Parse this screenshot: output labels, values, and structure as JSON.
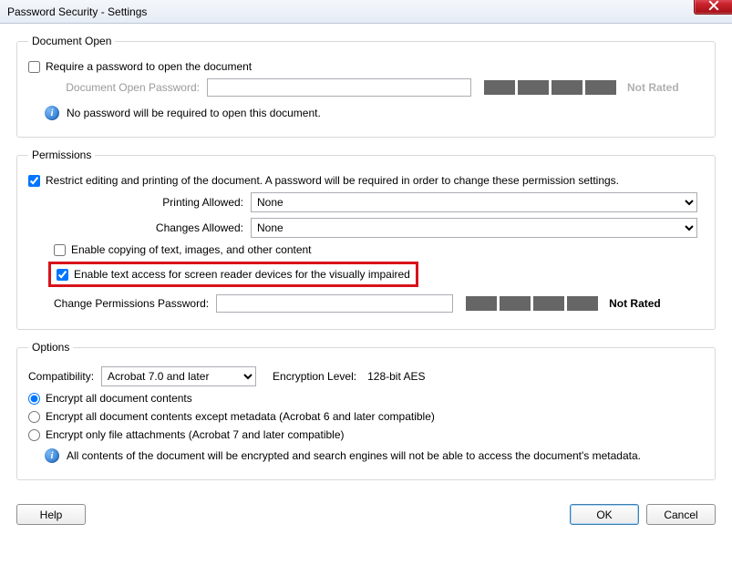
{
  "window": {
    "title": "Password Security - Settings"
  },
  "document_open": {
    "legend": "Document Open",
    "require_label": "Require a password to open the document",
    "require_checked": false,
    "password_label": "Document Open Password:",
    "password_value": "",
    "strength_label": "Not Rated",
    "info_text": "No password will be required to open this document."
  },
  "permissions": {
    "legend": "Permissions",
    "restrict_label": "Restrict editing and printing of the document. A password will be required in order to change these permission settings.",
    "restrict_checked": true,
    "printing_label": "Printing Allowed:",
    "printing_value": "None",
    "changes_label": "Changes Allowed:",
    "changes_value": "None",
    "copy_label": "Enable copying of text, images, and other content",
    "copy_checked": false,
    "access_label": "Enable text access for screen reader devices for the visually impaired",
    "access_checked": true,
    "change_pw_label": "Change Permissions Password:",
    "change_pw_value": "",
    "strength_label": "Not Rated"
  },
  "options": {
    "legend": "Options",
    "compat_label": "Compatibility:",
    "compat_value": "Acrobat 7.0 and later",
    "enc_level_label": "Encryption  Level:",
    "enc_level_value": "128-bit AES",
    "radio_all": "Encrypt all document contents",
    "radio_meta": "Encrypt all document contents except metadata (Acrobat 6 and later compatible)",
    "radio_attach": "Encrypt only file attachments (Acrobat 7 and later compatible)",
    "radio_selected": "all",
    "info_text": "All contents of the document will be encrypted and search engines will not be able to access the document's metadata."
  },
  "buttons": {
    "help": "Help",
    "ok": "OK",
    "cancel": "Cancel"
  }
}
